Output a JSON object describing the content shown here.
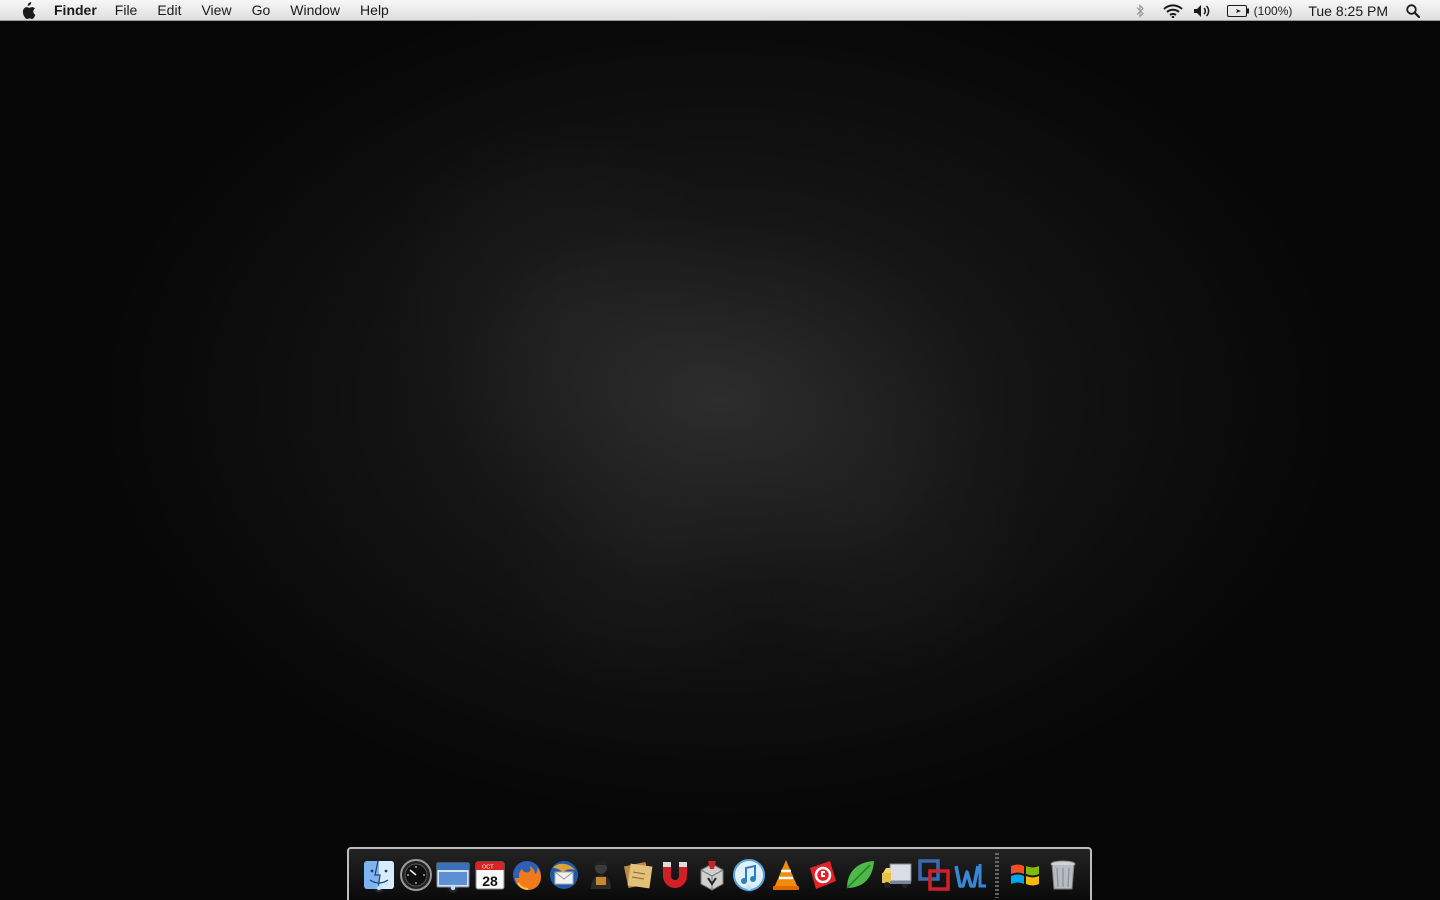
{
  "menubar": {
    "app_name": "Finder",
    "menus": [
      "File",
      "Edit",
      "View",
      "Go",
      "Window",
      "Help"
    ],
    "battery_percent": "(100%)",
    "clock": "Tue 8:25 PM"
  },
  "dock": {
    "apps": [
      {
        "icon": "finder-icon",
        "running": true
      },
      {
        "icon": "dashboard-icon",
        "running": false
      },
      {
        "icon": "window-icon",
        "running": true
      },
      {
        "icon": "ical-icon",
        "date_label": "28",
        "month_label": "OCT",
        "running": false
      },
      {
        "icon": "firefox-icon",
        "running": false
      },
      {
        "icon": "thunderbird-icon",
        "running": false
      },
      {
        "icon": "adium-user-icon",
        "running": false
      },
      {
        "icon": "stickies-icon",
        "running": false
      },
      {
        "icon": "magnet-icon",
        "running": false
      },
      {
        "icon": "installer-icon",
        "running": false
      },
      {
        "icon": "itunes-icon",
        "running": true
      },
      {
        "icon": "vlc-icon",
        "running": false
      },
      {
        "icon": "ccleaner-icon",
        "running": false
      },
      {
        "icon": "leaf-icon",
        "running": false
      },
      {
        "icon": "transmit-icon",
        "running": false
      },
      {
        "icon": "vmware-icon",
        "running": false
      },
      {
        "icon": "word-icon",
        "running": false
      },
      {
        "icon": "windows-icon",
        "running": false
      },
      {
        "icon": "trash-icon",
        "running": false
      }
    ]
  },
  "colors": {
    "desktop_bg": "#0b0b0b",
    "menubar_bg": "#e8e8e8",
    "dock_border": "#bdbdbd"
  }
}
